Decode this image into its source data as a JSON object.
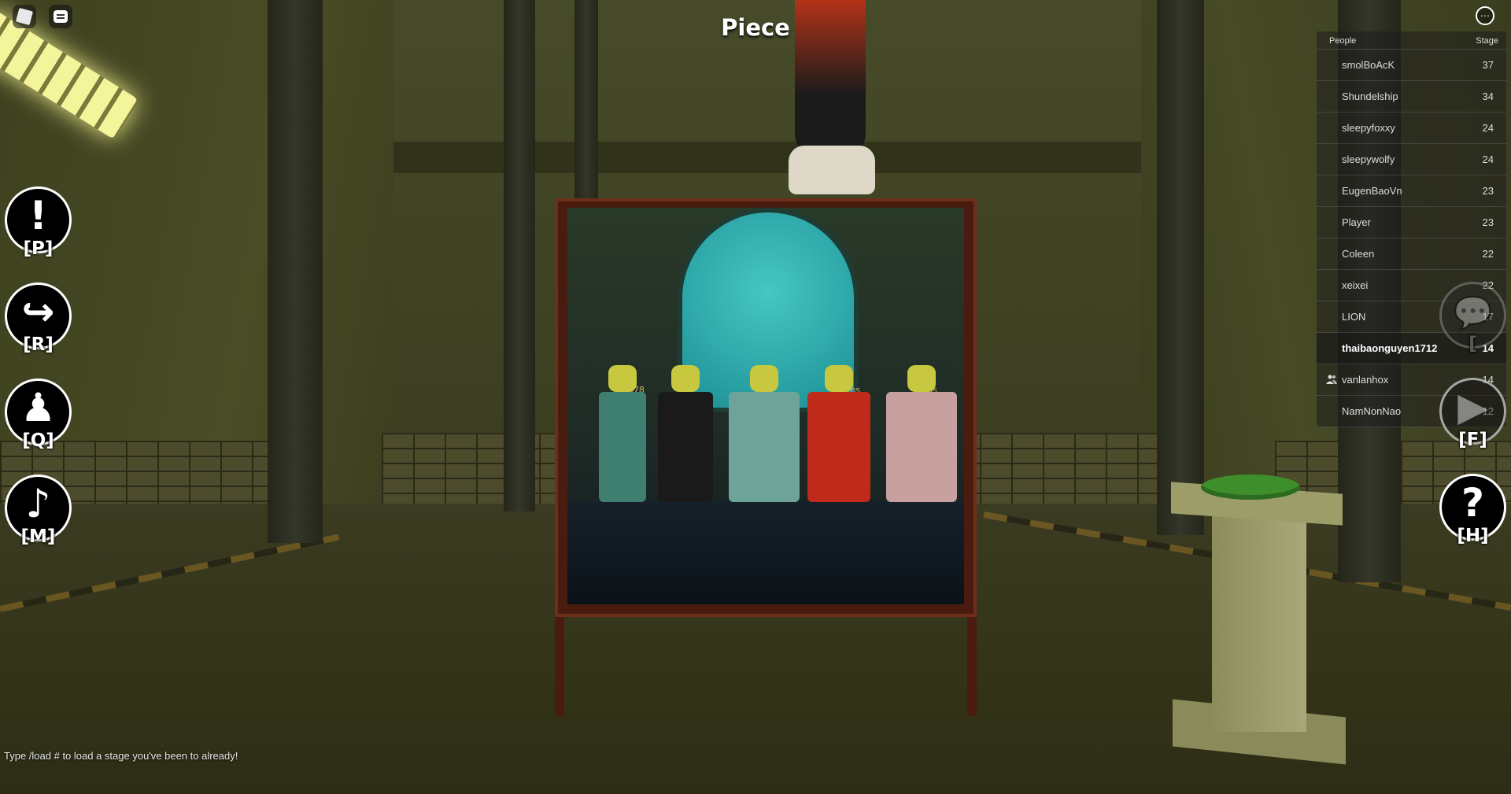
{
  "hud": {
    "stage_name": "Piece",
    "hint": "Type /load # to load a stage you've been to already!"
  },
  "left_buttons": [
    {
      "name": "report",
      "glyph": "!",
      "key": "[P]",
      "icon": "exclamation-icon"
    },
    {
      "name": "reset",
      "glyph": "↪",
      "key": "[R]",
      "icon": "redo-arrow-icon"
    },
    {
      "name": "avatar",
      "glyph": "♟",
      "key": "[Q]",
      "icon": "avatar-icon"
    },
    {
      "name": "music",
      "glyph": "♪",
      "key": "[M]",
      "icon": "music-note-icon"
    }
  ],
  "right_buttons": [
    {
      "name": "chat",
      "glyph": "💬",
      "key": "[",
      "icon": "chat-bubble-icon"
    },
    {
      "name": "forward",
      "glyph": "▶",
      "key": "[F]",
      "icon": "play-icon"
    },
    {
      "name": "help",
      "glyph": "?",
      "key": "[H]",
      "icon": "question-icon"
    }
  ],
  "board_names": [
    "Kai378",
    "Fritos",
    "7ohms"
  ],
  "leaderboard": {
    "col_people": "People",
    "col_stage": "Stage",
    "rows": [
      {
        "name": "smolBoAcK",
        "stage": "37"
      },
      {
        "name": "Shundelship",
        "stage": "34"
      },
      {
        "name": "sleepyfoxxy",
        "stage": "24"
      },
      {
        "name": "sleepywolfy",
        "stage": "24"
      },
      {
        "name": "EugenBaoVn",
        "stage": "23"
      },
      {
        "name": "Player",
        "stage": "23"
      },
      {
        "name": "Coleen",
        "stage": "22"
      },
      {
        "name": "xeixei",
        "stage": "22"
      },
      {
        "name": "LION",
        "stage": "17"
      },
      {
        "name": "thaibaonguyen1712",
        "stage": "14"
      },
      {
        "name": "vanlanhox",
        "stage": "14"
      },
      {
        "name": "NamNonNao",
        "stage": "12"
      }
    ]
  },
  "colors": {
    "accent_green": "#3e8f2b",
    "board_frame": "#6d2e1a"
  }
}
